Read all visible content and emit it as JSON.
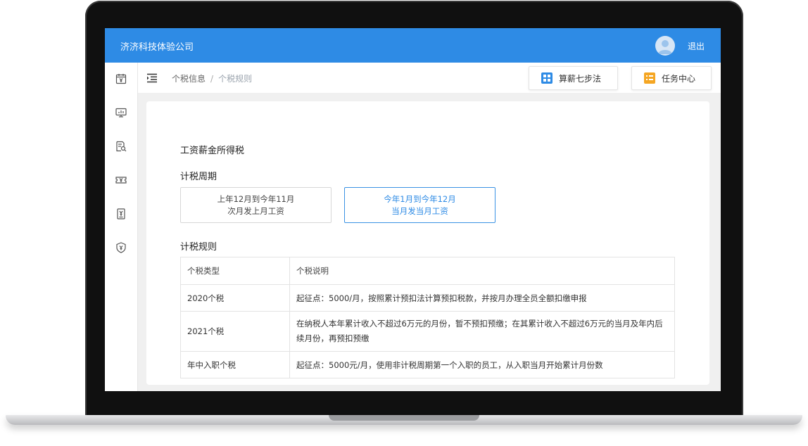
{
  "header": {
    "company": "济济科技体验公司",
    "logout_label": "退出",
    "avatar_icon": "user-avatar-icon"
  },
  "sidebar": {
    "icons": [
      "calendar-yen-icon",
      "monitor-chart-icon",
      "document-search-icon",
      "ticket-yen-icon",
      "receipt-yen-icon",
      "shield-yen-icon"
    ]
  },
  "breadcrumb": {
    "parent": "个税信息",
    "separator": "/",
    "current": "个税规则"
  },
  "toolbar": {
    "salary_steps_label": "算薪七步法",
    "task_center_label": "任务中心",
    "salary_steps_color": "#2e8be5",
    "task_center_color": "#f5a623"
  },
  "main": {
    "title": "工资薪金所得税",
    "period_heading": "计税周期",
    "period_options": [
      {
        "line1": "上年12月到今年11月",
        "line2": "次月发上月工资",
        "selected": false
      },
      {
        "line1": "今年1月到今年12月",
        "line2": "当月发当月工资",
        "selected": true
      }
    ],
    "rules_heading": "计税规则",
    "table": {
      "headers": [
        "个税类型",
        "个税说明"
      ],
      "rows": [
        [
          "2020个税",
          "起征点：5000/月，按照累计预扣法计算预扣税款，并按月办理全员全额扣缴申报"
        ],
        [
          "2021个税",
          "在纳税人本年累计收入不超过6万元的月份，暂不预扣预缴；在其累计收入不超过6万元的当月及年内后续月份，再预扣预缴"
        ],
        [
          "年中入职个税",
          "起征点：5000元/月，使用非计税周期第一个入职的员工，从入职当月开始累计月份数"
        ]
      ]
    }
  },
  "colors": {
    "header_blue": "#2e8be5",
    "active_border": "#3b92e4"
  }
}
